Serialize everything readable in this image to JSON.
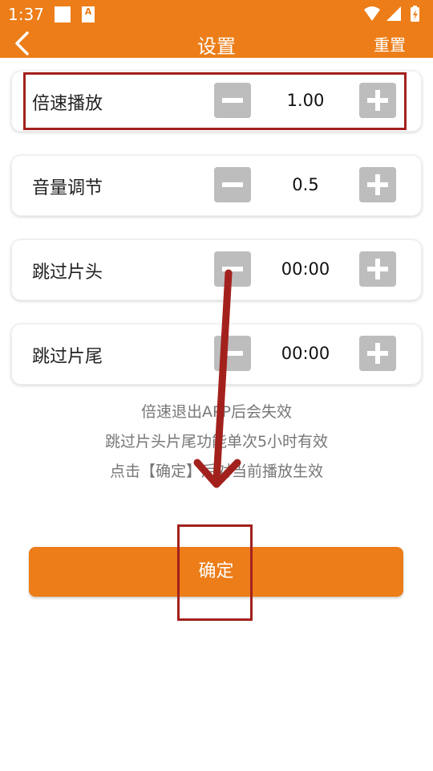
{
  "status_bar": {
    "time": "1:37",
    "a_badge": "A",
    "icons": [
      "square-icon",
      "a-badge-icon",
      "wifi-icon",
      "signal-icon",
      "battery-icon"
    ]
  },
  "header": {
    "title": "设置",
    "reset_label": "重置",
    "back_icon": "chevron-left-icon",
    "background_color": "#ec7d18"
  },
  "settings": [
    {
      "label": "倍速播放",
      "value": "1.00"
    },
    {
      "label": "音量调节",
      "value": "0.5"
    },
    {
      "label": "跳过片头",
      "value": "00:00"
    },
    {
      "label": "跳过片尾",
      "value": "00:00"
    }
  ],
  "notes": [
    "倍速退出APP后会失效",
    "跳过片头片尾功能单次5小时有效",
    "点击【确定】后对当前播放生效"
  ],
  "confirm_label": "确定",
  "colors": {
    "accent": "#ec7d18",
    "stepper_bg": "#bdbdbd",
    "annotation": "#a3211d"
  }
}
